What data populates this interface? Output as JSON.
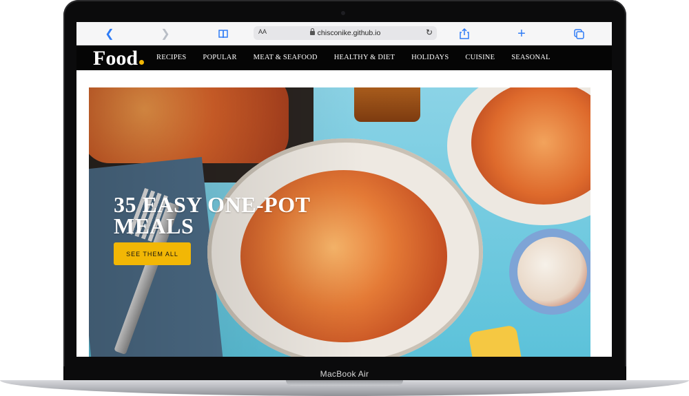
{
  "device": {
    "label": "MacBook Air"
  },
  "browser": {
    "back_icon": "chevron-left-icon",
    "forward_icon": "chevron-right-icon",
    "bookmarks_icon": "book-icon",
    "text_size_label": "AA",
    "url": "chisconike.github.io",
    "reload_icon": "reload-icon",
    "share_icon": "share-icon",
    "new_tab_icon": "plus-icon",
    "tabs_icon": "tabs-icon",
    "accent": "#2f7cf6"
  },
  "site": {
    "logo": "Food",
    "logo_dot_color": "#f2b705",
    "nav": [
      "RECIPES",
      "POPULAR",
      "MEAT & SEAFOOD",
      "HEALTHY & DIET",
      "HOLIDAYS",
      "CUISINE",
      "SEASONAL"
    ]
  },
  "hero": {
    "headline": "35 EASY ONE-POT MEALS",
    "cta": "SEE THEM ALL",
    "cta_color": "#f2b705"
  }
}
